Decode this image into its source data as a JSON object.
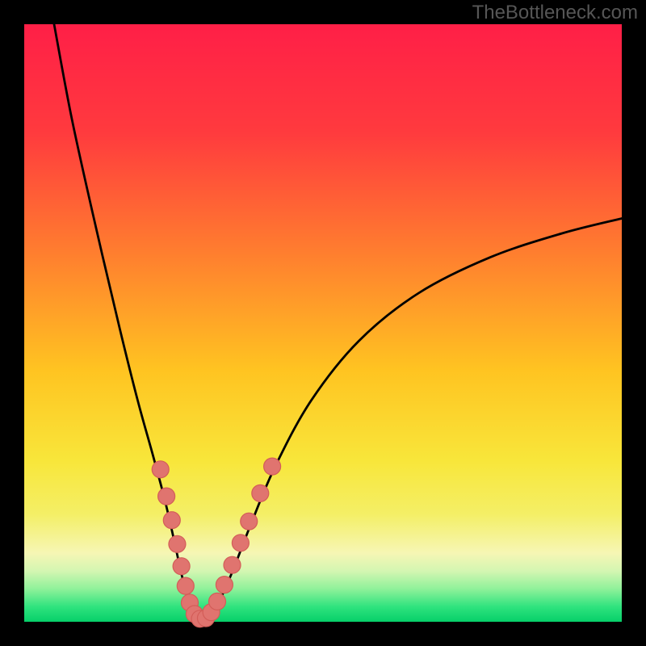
{
  "attribution": "TheBottleneck.com",
  "frame": {
    "outer": 800,
    "border": 30
  },
  "gradient": {
    "stops": [
      {
        "offset": 0.0,
        "color": "#ff1f47"
      },
      {
        "offset": 0.18,
        "color": "#ff3a3e"
      },
      {
        "offset": 0.38,
        "color": "#ff7d2f"
      },
      {
        "offset": 0.58,
        "color": "#ffc421"
      },
      {
        "offset": 0.73,
        "color": "#f8e63a"
      },
      {
        "offset": 0.82,
        "color": "#f4ef66"
      },
      {
        "offset": 0.885,
        "color": "#f6f6b4"
      },
      {
        "offset": 0.915,
        "color": "#d4f6b2"
      },
      {
        "offset": 0.945,
        "color": "#8ff19a"
      },
      {
        "offset": 0.975,
        "color": "#2fe37e"
      },
      {
        "offset": 1.0,
        "color": "#06cf69"
      }
    ]
  },
  "chart_data": {
    "type": "line",
    "title": "",
    "xlabel": "",
    "ylabel": "",
    "xlim": [
      0,
      100
    ],
    "ylim": [
      0,
      100
    ],
    "series": [
      {
        "name": "curve",
        "x": [
          5,
          8,
          12,
          16,
          19,
          21.5,
          23.5,
          25,
          26.2,
          27.2,
          28,
          29,
          30,
          31.5,
          33,
          35,
          38,
          42,
          48,
          56,
          66,
          78,
          90,
          100
        ],
        "y": [
          100,
          84,
          66,
          49,
          37,
          28,
          20.5,
          14,
          8.5,
          4.5,
          2,
          0.6,
          0.6,
          1.7,
          4.2,
          8.8,
          16.5,
          26,
          37,
          47,
          55,
          61,
          65,
          67.5
        ]
      }
    ],
    "markers": [
      {
        "x": 22.8,
        "y": 25.5
      },
      {
        "x": 23.8,
        "y": 21.0
      },
      {
        "x": 24.7,
        "y": 17.0
      },
      {
        "x": 25.6,
        "y": 13.0
      },
      {
        "x": 26.3,
        "y": 9.3
      },
      {
        "x": 27.0,
        "y": 6.0
      },
      {
        "x": 27.7,
        "y": 3.2
      },
      {
        "x": 28.5,
        "y": 1.3
      },
      {
        "x": 29.4,
        "y": 0.5
      },
      {
        "x": 30.4,
        "y": 0.6
      },
      {
        "x": 31.3,
        "y": 1.6
      },
      {
        "x": 32.3,
        "y": 3.4
      },
      {
        "x": 33.5,
        "y": 6.2
      },
      {
        "x": 34.8,
        "y": 9.5
      },
      {
        "x": 36.2,
        "y": 13.2
      },
      {
        "x": 37.6,
        "y": 16.8
      },
      {
        "x": 39.5,
        "y": 21.5
      },
      {
        "x": 41.5,
        "y": 26.0
      }
    ],
    "marker_style": {
      "r": 10.5,
      "fill": "#e0746f",
      "stroke": "#d35d58",
      "stroke_width": 1.2
    },
    "curve_style": {
      "stroke": "#000000",
      "width": 2.8
    }
  }
}
